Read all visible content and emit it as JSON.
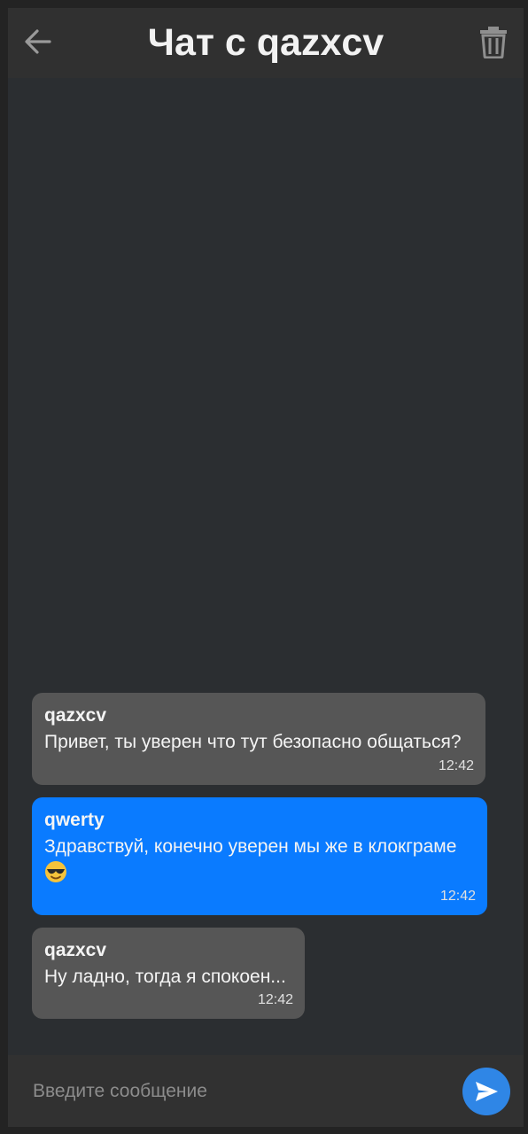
{
  "header": {
    "title": "Чат с qazxcv",
    "back_icon": "arrow-left-icon",
    "delete_icon": "trash-icon"
  },
  "messages": [
    {
      "sender": "qazxcv",
      "text": "Привет, ты уверен что тут безопасно общаться?",
      "time": "12:42",
      "direction": "incoming"
    },
    {
      "sender": "qwerty",
      "text": "Здравствуй, конечно уверен мы же в клокграме",
      "emoji": "smiling-face-with-sunglasses-icon",
      "time": "12:42",
      "direction": "outgoing"
    },
    {
      "sender": "qazxcv",
      "text": "Ну ладно, тогда я спокоен...",
      "time": "12:42",
      "direction": "incoming"
    }
  ],
  "composer": {
    "placeholder": "Введите сообщение",
    "value": "",
    "send_icon": "send-icon"
  },
  "colors": {
    "background": "#2b2e31",
    "header": "#303030",
    "incoming_bubble": "#565656",
    "outgoing_bubble": "#0a7bff",
    "send_button": "#2f86e6"
  }
}
